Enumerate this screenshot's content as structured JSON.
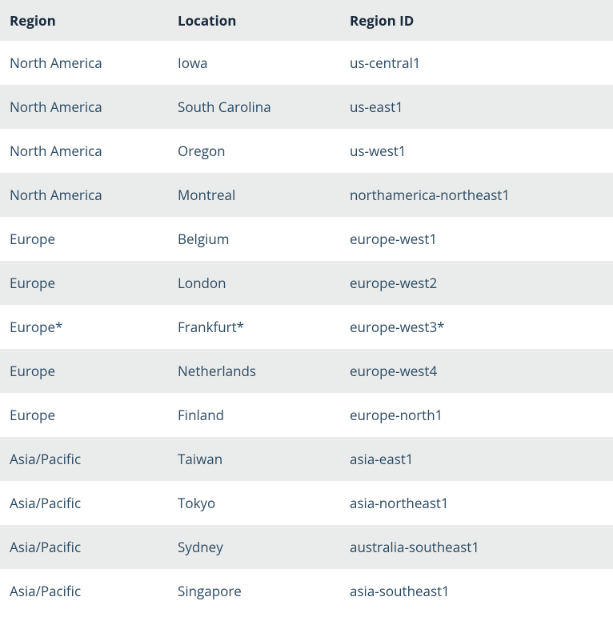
{
  "table": {
    "headers": {
      "region": "Region",
      "location": "Location",
      "regionId": "Region ID"
    },
    "rows": [
      {
        "region": "North America",
        "location": "Iowa",
        "regionId": "us-central1"
      },
      {
        "region": "North America",
        "location": "South Carolina",
        "regionId": "us-east1"
      },
      {
        "region": "North America",
        "location": "Oregon",
        "regionId": "us-west1"
      },
      {
        "region": "North America",
        "location": "Montreal",
        "regionId": "northamerica-northeast1"
      },
      {
        "region": "Europe",
        "location": "Belgium",
        "regionId": "europe-west1"
      },
      {
        "region": "Europe",
        "location": "London",
        "regionId": "europe-west2"
      },
      {
        "region": "Europe*",
        "location": "Frankfurt*",
        "regionId": "europe-west3*"
      },
      {
        "region": "Europe",
        "location": "Netherlands",
        "regionId": "europe-west4"
      },
      {
        "region": "Europe",
        "location": "Finland",
        "regionId": "europe-north1"
      },
      {
        "region": "Asia/Pacific",
        "location": "Taiwan",
        "regionId": "asia-east1"
      },
      {
        "region": "Asia/Pacific",
        "location": "Tokyo",
        "regionId": "asia-northeast1"
      },
      {
        "region": "Asia/Pacific",
        "location": "Sydney",
        "regionId": "australia-southeast1"
      },
      {
        "region": "Asia/Pacific",
        "location": "Singapore",
        "regionId": "asia-southeast1"
      }
    ]
  }
}
